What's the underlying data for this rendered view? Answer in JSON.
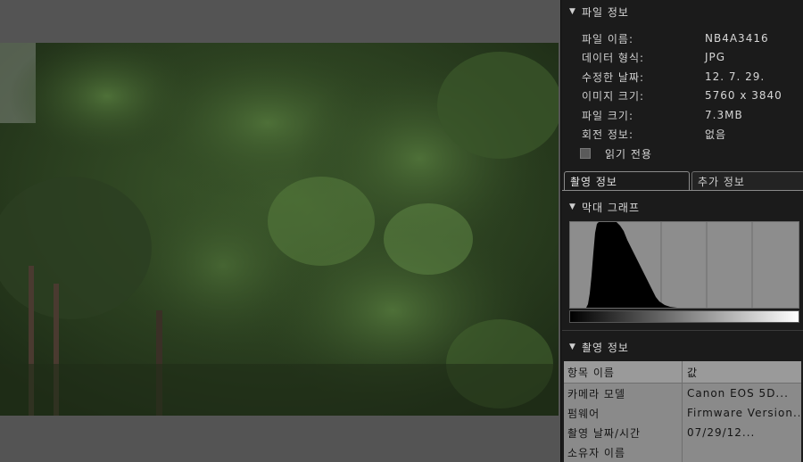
{
  "viewer": {
    "image_name": "NB4A3416"
  },
  "file_info": {
    "header": "파일 정보",
    "rows": [
      {
        "label": "파일 이름:",
        "value": "NB4A3416"
      },
      {
        "label": "데이터 형식:",
        "value": "JPG"
      },
      {
        "label": "수정한 날짜:",
        "value": "12. 7. 29."
      },
      {
        "label": "이미지 크기:",
        "value": "5760 x 3840"
      },
      {
        "label": "파일 크기:",
        "value": "7.3MB"
      },
      {
        "label": "회전 정보:",
        "value": "없음"
      }
    ],
    "read_only_label": "읽기 전용",
    "read_only_checked": false
  },
  "tabs": [
    {
      "label": "촬영 정보",
      "active": true
    },
    {
      "label": "추가 정보",
      "active": false
    }
  ],
  "histogram": {
    "header": "막대 그래프"
  },
  "shooting_info": {
    "header": "촬영 정보",
    "columns": [
      "항목 이름",
      "값"
    ],
    "rows": [
      {
        "name": "카메라 모델",
        "value": "Canon EOS 5D..."
      },
      {
        "name": "펌웨어",
        "value": "Firmware Version..."
      },
      {
        "name": "촬영 날짜/시간",
        "value": "07/29/12..."
      },
      {
        "name": "소유자 이름",
        "value": ""
      }
    ]
  },
  "colors": {
    "panel_bg": "#1b1b1b",
    "viewer_bg": "#545454",
    "histogram_bg": "#8d8d8d",
    "table_bg": "#8a8a8a"
  }
}
